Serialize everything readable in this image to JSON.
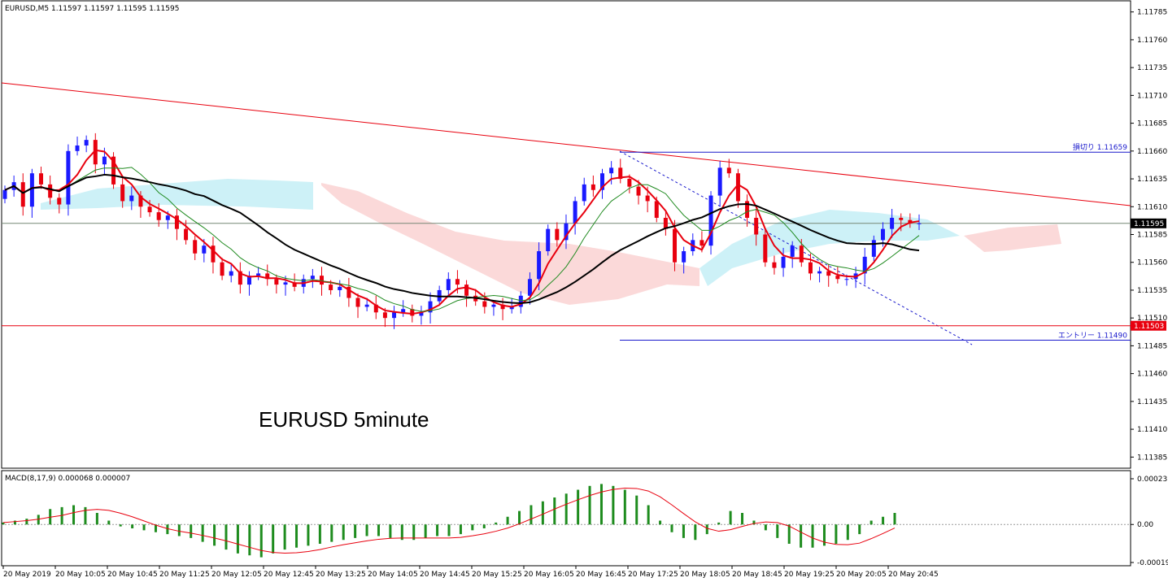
{
  "window": {
    "symbol_info": "EURUSD,M5  1.11597 1.11597 1.11595 1.11595",
    "chart_caption": "EURUSD 5minute",
    "macd_info": "MACD(8,17,9) 0.000068 0.000007"
  },
  "price_axis": {
    "ticks": [
      "1.11785",
      "1.11760",
      "1.11735",
      "1.11710",
      "1.11685",
      "1.11660",
      "1.11635",
      "1.11610",
      "1.11585",
      "1.11560",
      "1.11535",
      "1.11510",
      "1.11485",
      "1.11460",
      "1.11435",
      "1.11410",
      "1.11385"
    ],
    "current_price_label": "1.11595",
    "red_level_label": "1.11503"
  },
  "macd_axis": {
    "ticks": [
      "0.000237",
      "0.00",
      "-0.000197"
    ]
  },
  "time_axis": [
    "20 May 2019",
    "20 May 10:05",
    "20 May 10:45",
    "20 May 11:25",
    "20 May 12:05",
    "20 May 12:45",
    "20 May 13:25",
    "20 May 14:05",
    "20 May 14:45",
    "20 May 15:25",
    "20 May 16:05",
    "20 May 16:45",
    "20 May 17:25",
    "20 May 18:05",
    "20 May 18:45",
    "20 May 19:25",
    "20 May 20:05",
    "20 May 20:45"
  ],
  "annotations": {
    "stop_loss": "損切り 1.11659",
    "entry": "エントリー 1.11490"
  },
  "colors": {
    "bull": "#1a1aff",
    "bear": "#e8000e",
    "ma_fast": "#e8000e",
    "ma_mid": "#1f8a1f",
    "ma_slow": "#000000",
    "cloud_up": "#cdf1f7",
    "cloud_down": "#fbd9d9",
    "macd_hist": "#1e8c1e",
    "macd_signal": "#e8000e",
    "hline_blue": "#1a1acc",
    "hline_red": "#e8000e"
  },
  "chart_data": {
    "type": "candlestick",
    "symbol": "EURUSD",
    "timeframe": "M5",
    "ylim": [
      1.11375,
      1.11795
    ],
    "closes": [
      1.11625,
      1.11632,
      1.1161,
      1.1164,
      1.1163,
      1.11618,
      1.11612,
      1.1166,
      1.11665,
      1.1167,
      1.11648,
      1.11655,
      1.1163,
      1.11615,
      1.1162,
      1.1161,
      1.11605,
      1.11598,
      1.11602,
      1.1159,
      1.1158,
      1.11568,
      1.11575,
      1.1156,
      1.11548,
      1.11552,
      1.1154,
      1.11548,
      1.1155,
      1.11545,
      1.1154,
      1.11542,
      1.11538,
      1.11545,
      1.11548,
      1.1154,
      1.11535,
      1.11538,
      1.11528,
      1.1152,
      1.11522,
      1.11515,
      1.1151,
      1.11515,
      1.11518,
      1.11512,
      1.11515,
      1.11525,
      1.11535,
      1.11545,
      1.1154,
      1.1153,
      1.11525,
      1.1152,
      1.11522,
      1.11518,
      1.1152,
      1.1153,
      1.11545,
      1.1157,
      1.1159,
      1.1158,
      1.11595,
      1.11615,
      1.1163,
      1.11625,
      1.1164,
      1.11645,
      1.11635,
      1.11628,
      1.1162,
      1.11615,
      1.116,
      1.1159,
      1.1156,
      1.1157,
      1.1158,
      1.11575,
      1.1162,
      1.11645,
      1.1164,
      1.11615,
      1.116,
      1.11585,
      1.1156,
      1.11555,
      1.11565,
      1.11575,
      1.1156,
      1.1155,
      1.11552,
      1.11548,
      1.11545,
      1.11545,
      1.1155,
      1.11565,
      1.1158,
      1.1159,
      1.116,
      1.11598,
      1.11595,
      1.11595
    ],
    "ma_fast_period": "short",
    "ma_mid_period": "mid",
    "ma_slow_period": "long",
    "horizontal_levels": [
      {
        "label": "損切り 1.11659",
        "price": 1.11659,
        "color": "blue"
      },
      {
        "label": "current",
        "price": 1.11595,
        "color": "gray"
      },
      {
        "label": "1.11503",
        "price": 1.11503,
        "color": "red"
      },
      {
        "label": "エントリー 1.11490",
        "price": 1.1149,
        "color": "blue"
      }
    ],
    "macd": {
      "ylim": [
        -0.000197,
        0.000237
      ],
      "histogram": [
        1e-05,
        2e-05,
        3e-05,
        5e-05,
        8e-05,
        9e-05,
        0.0001,
        9e-05,
        6e-05,
        2e-05,
        -1e-05,
        -2e-05,
        -3e-05,
        -4e-05,
        -5e-05,
        -6e-05,
        -7e-05,
        -9e-05,
        -0.00011,
        -0.00013,
        -0.00015,
        -0.00016,
        -0.00017,
        -0.00015,
        -0.00013,
        -0.00012,
        -0.00011,
        -0.0001,
        -9e-05,
        -8e-05,
        -7e-05,
        -6e-05,
        -6e-05,
        -7e-05,
        -8e-05,
        -8e-05,
        -7e-05,
        -6e-05,
        -6e-05,
        -5e-05,
        -3e-05,
        -2e-05,
        1e-05,
        4e-05,
        7e-05,
        0.0001,
        0.00012,
        0.00014,
        0.00016,
        0.00018,
        0.0002,
        0.00021,
        0.0002,
        0.00018,
        0.00015,
        0.0001,
        2e-05,
        -4e-05,
        -7e-05,
        -8e-05,
        -5e-05,
        1e-05,
        7e-05,
        6e-05,
        2e-05,
        -3e-05,
        -7e-05,
        -0.0001,
        -0.00012,
        -0.00012,
        -0.00011,
        -0.0001,
        -8e-05,
        -5e-05,
        2e-05,
        4e-05,
        6e-05
      ]
    }
  }
}
